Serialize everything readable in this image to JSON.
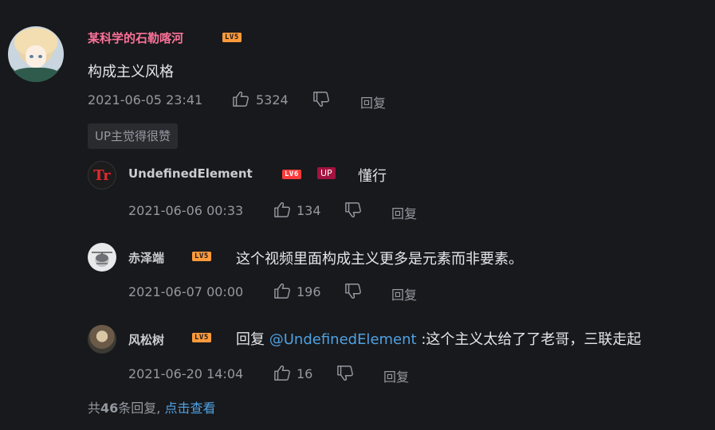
{
  "main_comment": {
    "username": "某科学的石勒喀河",
    "level": "LV5",
    "content": "构成主义风格",
    "date": "2021-06-05 23:41",
    "likes": "5324",
    "reply_label": "回复",
    "up_liked": "UP主觉得很赞"
  },
  "replies": [
    {
      "username": "UndefinedElement",
      "level": "LV6",
      "badge": "UP",
      "avatar_text": "Tr",
      "content": "懂行",
      "date": "2021-06-06 00:33",
      "likes": "134",
      "reply_label": "回复"
    },
    {
      "username": "赤泽端",
      "level": "LV5",
      "content": "这个视频里面构成主义更多是元素而非要素。",
      "date": "2021-06-07 00:00",
      "likes": "196",
      "reply_label": "回复"
    },
    {
      "username": "风松树",
      "level": "LV5",
      "content_prefix": "回复 ",
      "mention": "@UndefinedElement",
      "content": " :这个主义太给了了老哥，三联走起",
      "date": "2021-06-20 14:04",
      "likes": "16",
      "reply_label": "回复"
    }
  ],
  "footer": {
    "prefix": "共",
    "count": "46",
    "suffix": "条回复,",
    "view_more": "点击查看"
  },
  "colors": {
    "background": "#18191c",
    "username_pink": "#fb7299",
    "link_blue": "#4fa1e2",
    "level_orange": "#ff9a3c",
    "level_red": "#ff3b3b",
    "up_badge": "#a2133f"
  },
  "icons": [
    "thumbs-up-icon",
    "thumbs-down-icon"
  ]
}
